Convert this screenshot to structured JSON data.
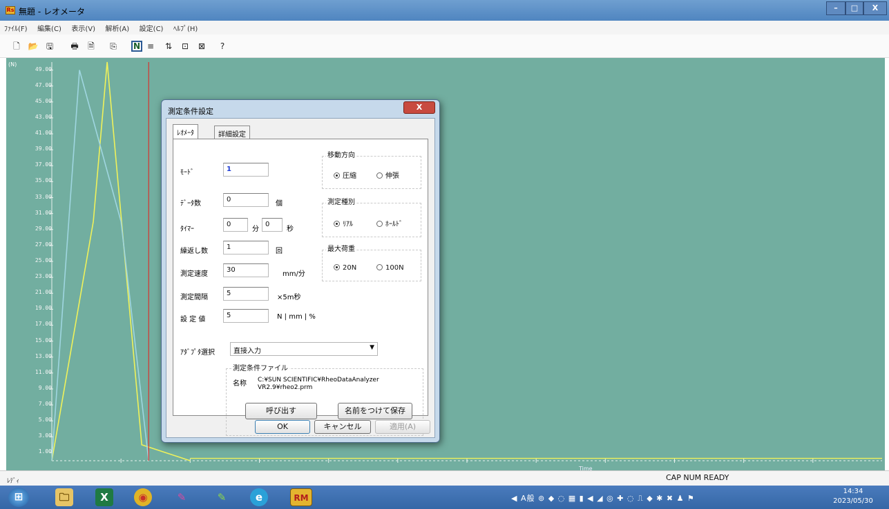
{
  "window": {
    "title": "無題 - レオメータ",
    "app_icon": "Rs",
    "minimize": "–",
    "maximize": "□",
    "close": "X"
  },
  "menu": [
    "ﾌｧｲﾙ(F)",
    "編集(C)",
    "表示(V)",
    "解析(A)",
    "設定(C)",
    "ﾍﾙﾌﾟ(H)"
  ],
  "toolbar": {
    "icons": [
      "new-file-icon",
      "open-folder-icon",
      "save-icon",
      "print-icon",
      "print-preview-icon",
      "copy-icon",
      "n-mode-icon",
      "list-icon",
      "sort-icon",
      "window-icon",
      "chart-icon",
      "help-icon"
    ],
    "new": "🗋",
    "open": "📂",
    "save": "🖫",
    "print": "🖶",
    "preview": "🗎",
    "copy": "⎘",
    "n": "N",
    "list": "≡",
    "sort": "⇅",
    "win1": "⊡",
    "win2": "⊠",
    "help": "?"
  },
  "chart_data": {
    "type": "line",
    "y_ticks": [
      "49.00",
      "47.00",
      "45.00",
      "43.00",
      "41.00",
      "39.00",
      "37.00",
      "35.00",
      "33.00",
      "31.00",
      "29.00",
      "27.00",
      "25.00",
      "23.00",
      "21.00",
      "19.00",
      "17.00",
      "15.00",
      "13.00",
      "11.00",
      "9.00",
      "7.00",
      "5.00",
      "3.00",
      "1.00"
    ],
    "ylabel": "(N)",
    "xlabel": "Time",
    "ylim": [
      0,
      50
    ],
    "xlim": [
      0,
      1200
    ],
    "background": "#72aea0",
    "series": [
      {
        "color": "#f0f25a",
        "x": [
          0,
          60,
          80,
          130,
          200
        ],
        "y": [
          0,
          30,
          50,
          2,
          0
        ]
      },
      {
        "color": "#9fd6e0",
        "x": [
          0,
          40,
          100,
          140
        ],
        "y": [
          0,
          49,
          30,
          0
        ]
      }
    ],
    "cursor_x": 140,
    "cursor_color": "#d8322f"
  },
  "dialog": {
    "title": "測定条件設定",
    "close": "X",
    "tabs": [
      "ﾚｵﾒｰﾀ",
      "詳細設定"
    ],
    "mode_label": "ﾓｰﾄﾞ",
    "mode_value": "1",
    "data_count_label": "ﾃﾞｰﾀ数",
    "data_count_value": "0",
    "data_count_unit": "個",
    "timer_label": "ﾀｲﾏｰ",
    "timer_min_value": "0",
    "timer_min_unit": "分",
    "timer_sec_value": "0",
    "timer_sec_unit": "秒",
    "repeat_label": "繰返し数",
    "repeat_value": "1",
    "repeat_unit": "回",
    "speed_label": "測定速度",
    "speed_value": "30",
    "speed_unit": "mm/分",
    "interval_label": "測定間隔",
    "interval_value": "5",
    "interval_unit": "×5m秒",
    "setpoint_label": "設 定 値",
    "setpoint_value": "5",
    "setpoint_unit": "N | mm | %",
    "direction": {
      "label": "移動方向",
      "opt1": "圧縮",
      "opt2": "伸張",
      "selected": 0
    },
    "measure_type": {
      "label": "測定種別",
      "opt1": "ﾘｱﾙ",
      "opt2": "ﾎｰﾙﾄﾞ",
      "selected": 0
    },
    "max_load": {
      "label": "最大荷重",
      "opt1": "20N",
      "opt2": "100N",
      "selected": 0
    },
    "adapter_label": "ｱﾀﾞﾌﾟﾀ選択",
    "adapter_value": "直接入力",
    "file_group": "測定条件ファイル",
    "file_name_label": "名称",
    "file_name_value": "C:¥SUN SCIENTIFIC¥RheoDataAnalyzer VR2.9¥rheo2.prm",
    "load_button": "呼び出す",
    "save_as_button": "名前をつけて保存",
    "ok": "OK",
    "cancel": "キャンセル",
    "apply": "適用(A)"
  },
  "status": {
    "left": "ﾚﾃﾞｨ",
    "right": "CAP  NUM  READY"
  },
  "taskbar": {
    "start": "⊞",
    "explorer": "🗀",
    "excel": "X",
    "chrome": "◉",
    "app1": "✎",
    "app2": "✎",
    "edge": "e",
    "rheo": "RM",
    "tray": "◀ A般 ⊚ ◆ ◌ ▦ ▮ ◀ ◢ ◎ ✚ ◌ ⎍ ◆ ✱ ✖ ♟ ⚑",
    "time": "14:34",
    "date": "2023/05/30"
  }
}
